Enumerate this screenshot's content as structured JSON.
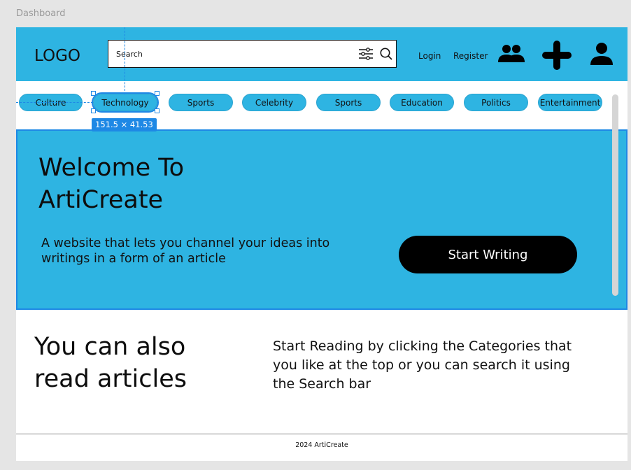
{
  "frame_label": "Dashboard",
  "header": {
    "logo": "LOGO",
    "search_text": "Search",
    "login": "Login",
    "register": "Register"
  },
  "categories": [
    "Culture",
    "Technology",
    "Sports",
    "Celebrity",
    "Sports",
    "Education",
    "Politics",
    "Entertainment"
  ],
  "selection": {
    "dimensions": "151.5 × 41.53"
  },
  "hero": {
    "title_line1": "Welcome To",
    "title_line2": "ArtiCreate",
    "subtitle": "A website that lets you channel your ideas into writings in a form of an article",
    "cta": "Start Writing"
  },
  "read": {
    "title_line1": "You can also",
    "title_line2": "read articles",
    "text": "Start Reading by clicking the Categories that you like at the top or you can search it using the Search bar"
  },
  "footer": {
    "text": "2024 ArtiCreate"
  },
  "colors": {
    "brand": "#2eb4e2",
    "selection": "#1e88e5",
    "cta_bg": "#000000"
  },
  "icons": [
    "filter-icon",
    "search-icon",
    "user-group-icon",
    "plus-icon",
    "account-icon"
  ]
}
